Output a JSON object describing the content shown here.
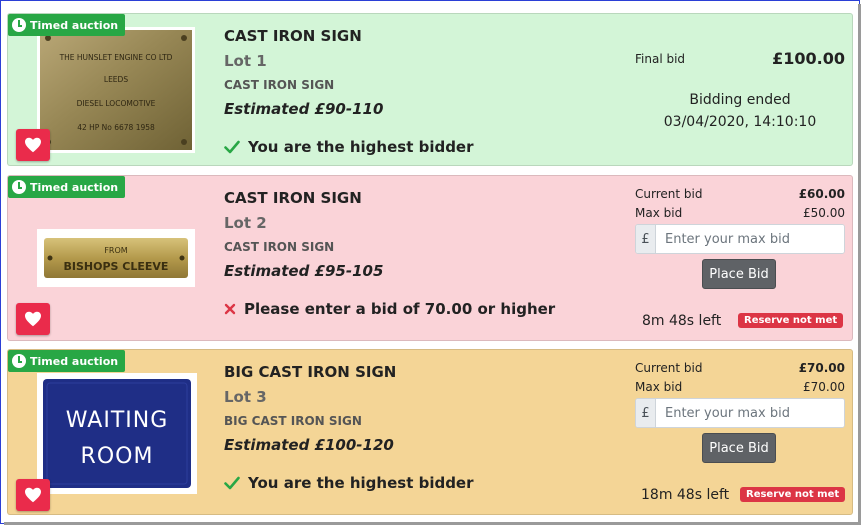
{
  "colors": {
    "badge": "#28a745",
    "card_won": "#d3f5d7",
    "card_error": "#fad3d8",
    "card_active": "#f4d596",
    "heart": "#ea2b4b",
    "reserve": "#dc3545",
    "button": "#5f6266"
  },
  "lots": [
    {
      "badge": "Timed auction",
      "title": "CAST IRON SIGN",
      "lot": "Lot 1",
      "subtitle": "CAST IRON SIGN",
      "estimate": "Estimated £90-110",
      "status_icon": "check-icon",
      "status": "You are the highest bidder",
      "image_text": [
        "THE HUNSLET ENGINE CO LTD",
        "LEEDS",
        "DIESEL LOCOMOTIVE",
        "42 HP No 6678 1958"
      ],
      "final_label": "Final bid",
      "final_value": "£100.00",
      "ended_line1": "Bidding ended",
      "ended_line2": "03/04/2020, 14:10:10"
    },
    {
      "badge": "Timed auction",
      "title": "CAST IRON SIGN",
      "lot": "Lot 2",
      "subtitle": "CAST IRON SIGN",
      "estimate": "Estimated £95-105",
      "status_icon": "cross-icon",
      "status": "Please enter a bid of 70.00 or higher",
      "image_text": [
        "FROM",
        "BISHOPS CLEEVE"
      ],
      "current_label": "Current bid",
      "current_value": "£60.00",
      "max_label": "Max bid",
      "max_value": "£50.00",
      "currency": "£",
      "placeholder": "Enter your max bid",
      "button": "Place Bid",
      "time_left": "8m 48s left",
      "reserve": "Reserve not met"
    },
    {
      "badge": "Timed auction",
      "title": "BIG CAST IRON SIGN",
      "lot": "Lot 3",
      "subtitle": "BIG CAST IRON SIGN",
      "estimate": "Estimated £100-120",
      "status_icon": "check-icon",
      "status": "You are the highest bidder",
      "image_text": [
        "WAITING",
        "ROOM"
      ],
      "current_label": "Current bid",
      "current_value": "£70.00",
      "max_label": "Max bid",
      "max_value": "£70.00",
      "currency": "£",
      "placeholder": "Enter your max bid",
      "button": "Place Bid",
      "time_left": "18m 48s left",
      "reserve": "Reserve not met"
    }
  ]
}
